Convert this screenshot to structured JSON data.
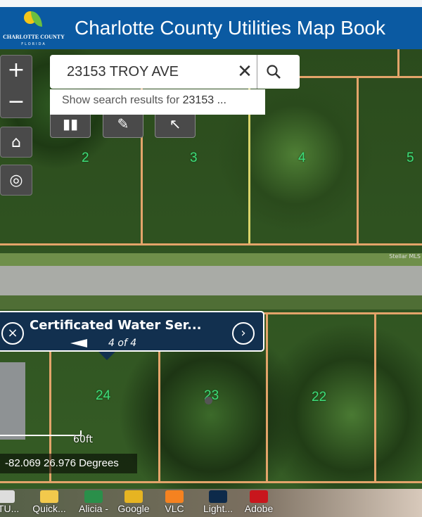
{
  "header": {
    "title": "Charlotte County Utilities Map Book",
    "logo_text": "CHARLOTTE COUNTY",
    "logo_subtext": "FLORIDA"
  },
  "map_controls": {
    "zoom_in": "+",
    "zoom_out": "−",
    "home_icon": "home-icon",
    "locate_icon": "crosshair-icon"
  },
  "tools": [
    {
      "icon": "basemap-gallery-icon"
    },
    {
      "icon": "measure-ruler-icon"
    },
    {
      "icon": "select-pointer-icon"
    }
  ],
  "search": {
    "value": "23153 TROY AVE",
    "suggestion_prefix": "Show search results for ",
    "suggestion_term": "23153 ..."
  },
  "lots": [
    "2",
    "3",
    "4",
    "5",
    "24",
    "23",
    "22"
  ],
  "popup": {
    "title": "Certificated Water Ser...",
    "count": "4 of 4"
  },
  "scale": {
    "label": "60ft"
  },
  "coordinates": "-82.069 26.976 Degrees",
  "attribution": "Stellar MLS",
  "desktop_icons": [
    "ATU...",
    "Quick...",
    "Alicia -",
    "Google",
    "VLC",
    "Light...",
    "Adobe"
  ],
  "colors": {
    "header": "#0b5aa2",
    "popup": "#12304f",
    "parcel_line": "#e3a46a",
    "lot_label": "#3fdc7a"
  }
}
